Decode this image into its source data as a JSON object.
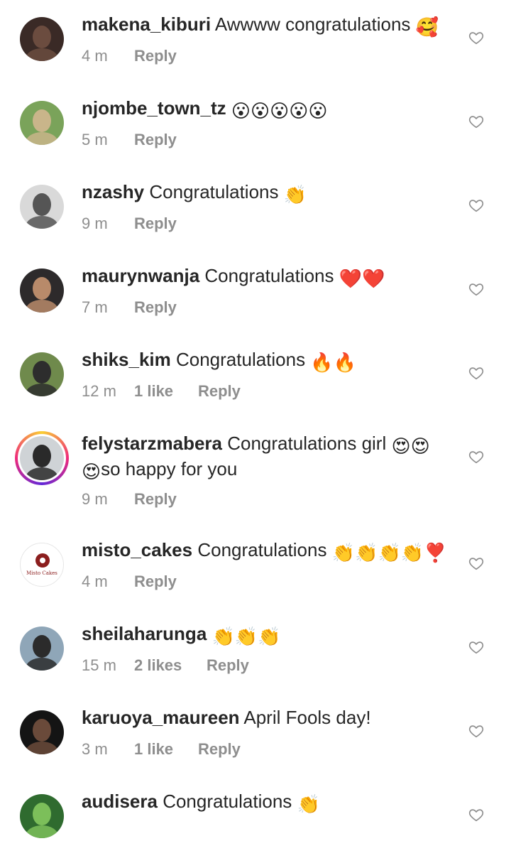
{
  "comments": [
    {
      "username": "makena_kiburi",
      "text": "Awwww congratulations",
      "emoji": "🥰",
      "time": "4 m",
      "likes": "",
      "reply": "Reply",
      "avatar": {
        "bg": "#3a2a26",
        "fg": "#6b4c3f"
      }
    },
    {
      "username": "njombe_town_tz",
      "text": "",
      "emoji": "😮😮😮😮😮",
      "time": "5 m",
      "likes": "",
      "reply": "Reply",
      "avatar": {
        "bg": "#7aa35a",
        "fg": "#c9b58a"
      }
    },
    {
      "username": "nzashy",
      "text": "Congratulations",
      "emoji": "👏",
      "time": "9 m",
      "likes": "",
      "reply": "Reply",
      "avatar": {
        "bg": "#d9d9d9",
        "fg": "#555555"
      }
    },
    {
      "username": "maurynwanja",
      "text": "Congratulations",
      "emoji": "❤️❤️",
      "time": "7 m",
      "likes": "",
      "reply": "Reply",
      "avatar": {
        "bg": "#2d2a2b",
        "fg": "#b88a6a"
      }
    },
    {
      "username": "shiks_kim",
      "text": "Congratulations",
      "emoji": "🔥🔥",
      "time": "12 m",
      "likes": "1 like",
      "reply": "Reply",
      "avatar": {
        "bg": "#6f8a4c",
        "fg": "#2d2d2d"
      }
    },
    {
      "username": "felystarzmabera",
      "text": "Congratulations girl",
      "emoji": "😍😍",
      "line2_emoji": "😍",
      "line2": "so happy for you",
      "time": "9 m",
      "likes": "",
      "reply": "Reply",
      "avatar": {
        "bg": "#cfd3d6",
        "fg": "#2a2a2a"
      },
      "story_ring": true
    },
    {
      "username": "misto_cakes",
      "text": "Congratulations",
      "emoji": "👏👏👏👏❣️",
      "time": "4 m",
      "likes": "",
      "reply": "Reply",
      "avatar": {
        "bg": "#ffffff",
        "fg": "#8b1e1e"
      },
      "logo_text": "Misto Cakes"
    },
    {
      "username": "sheilaharunga",
      "text": "",
      "emoji": "👏👏👏",
      "time": "15 m",
      "likes": "2 likes",
      "reply": "Reply",
      "avatar": {
        "bg": "#8fa6b8",
        "fg": "#2b2b2b"
      }
    },
    {
      "username": "karuoya_maureen",
      "text": "April Fools day!",
      "emoji": "",
      "time": "3 m",
      "likes": "1 like",
      "reply": "Reply",
      "avatar": {
        "bg": "#141414",
        "fg": "#6a4a3a"
      }
    },
    {
      "username": "audisera",
      "text": "Congratulations",
      "emoji": "👏",
      "time": "",
      "likes": "",
      "reply": "",
      "avatar": {
        "bg": "#2f6b2f",
        "fg": "#7cbf5a"
      }
    }
  ],
  "colors": {
    "text": "#262626",
    "meta": "#8e8e8e",
    "heart": "#8e8e8e"
  },
  "icons": {
    "like": "heart-outline-icon"
  }
}
